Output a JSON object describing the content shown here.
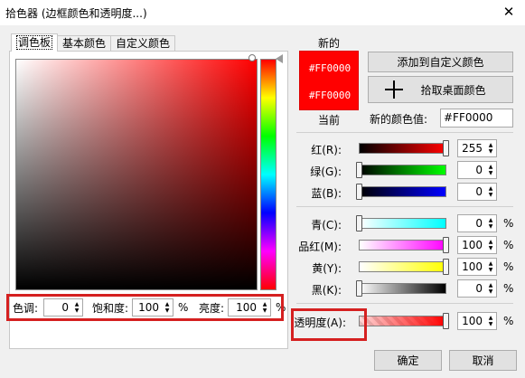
{
  "window": {
    "title": "拾色器 (边框颜色和透明度...)",
    "close_glyph": "✕"
  },
  "tabs": [
    {
      "label": "调色板",
      "active": true
    },
    {
      "label": "基本颜色",
      "active": false
    },
    {
      "label": "自定义颜色",
      "active": false
    }
  ],
  "hsl": {
    "hue_label": "色调:",
    "hue_value": "0",
    "saturation_label": "饱和度:",
    "saturation_value": "100",
    "saturation_unit": "%",
    "brightness_label": "亮度:",
    "brightness_value": "100",
    "brightness_unit": "%"
  },
  "preview": {
    "new_label": "新的",
    "current_label": "当前",
    "new_color_text": "#FF0000",
    "current_color_text": "#FF0000",
    "color": "#FF0000"
  },
  "actions": {
    "add_custom": "添加到自定义颜色",
    "pick_screen": "拾取桌面颜色"
  },
  "new_value": {
    "label": "新的颜色值:",
    "value": "#FF0000"
  },
  "rgb": [
    {
      "label": "红(R):",
      "value": "255",
      "unit": "",
      "level": 1.0
    },
    {
      "label": "绿(G):",
      "value": "0",
      "unit": "",
      "level": 0.0
    },
    {
      "label": "蓝(B):",
      "value": "0",
      "unit": "",
      "level": 0.0
    }
  ],
  "cmyk": [
    {
      "label": "青(C):",
      "value": "0",
      "unit": "%",
      "level": 0.0
    },
    {
      "label": "品红(M):",
      "value": "100",
      "unit": "%",
      "level": 1.0
    },
    {
      "label": "黄(Y):",
      "value": "100",
      "unit": "%",
      "level": 1.0
    },
    {
      "label": "黑(K):",
      "value": "0",
      "unit": "%",
      "level": 0.0
    }
  ],
  "alpha": {
    "label": "透明度(A):",
    "value": "100",
    "unit": "%",
    "level": 1.0
  },
  "buttons": {
    "ok": "确定",
    "cancel": "取消"
  },
  "icons": {
    "spin": "spin-arrows-icon",
    "add": "plus-icon"
  },
  "colors": {
    "highlight": "#D52020",
    "selected": "#FF0000"
  }
}
